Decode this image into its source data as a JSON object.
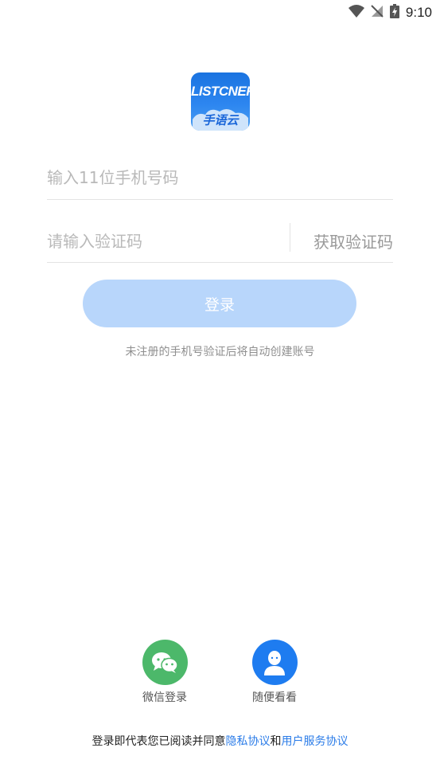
{
  "status_bar": {
    "time": "9:10",
    "icons": [
      "wifi-icon",
      "no-signal-icon",
      "battery-charging-icon"
    ]
  },
  "logo": {
    "top_text": "LISTCNER",
    "bottom_text": "手语云",
    "colors": {
      "background": "#1a73e0",
      "cloud": "#cfe4fb"
    }
  },
  "form": {
    "phone_placeholder": "输入11位手机号码",
    "phone_value": "",
    "code_placeholder": "请输入验证码",
    "code_value": "",
    "get_code_label": "获取验证码",
    "login_label": "登录",
    "hint": "未注册的手机号验证后将自动创建账号"
  },
  "alt_login": {
    "wechat": {
      "label": "微信登录",
      "icon": "wechat-icon",
      "color": "#4cb86a"
    },
    "guest": {
      "label": "随便看看",
      "icon": "user-icon",
      "color": "#1e7cf0"
    }
  },
  "agreement": {
    "prefix": "登录即代表您已阅读并同意",
    "privacy_link": "隐私协议",
    "connector": "和",
    "service_link": "用户服务协议"
  },
  "colors": {
    "accent": "#2b7ce8",
    "login_button": "#b8d6fb"
  }
}
